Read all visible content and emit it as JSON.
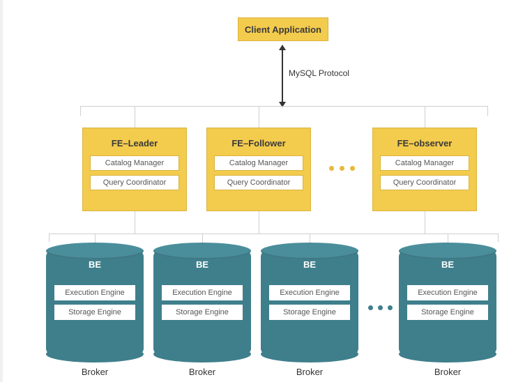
{
  "colors": {
    "yellow": "#f3cb4d",
    "yellow_border": "#d9b33e",
    "teal": "#3f7f8c",
    "teal_top": "#4a8e9b"
  },
  "client": {
    "label": "Client Application"
  },
  "protocol_label": "MySQL Protocol",
  "fe_row": {
    "ellipsis": "•••",
    "nodes": [
      {
        "title": "FE–Leader",
        "sub1": "Catalog Manager",
        "sub2": "Query Coordinator"
      },
      {
        "title": "FE–Follower",
        "sub1": "Catalog Manager",
        "sub2": "Query Coordinator"
      },
      {
        "title": "FE–observer",
        "sub1": "Catalog Manager",
        "sub2": "Query Coordinator"
      }
    ]
  },
  "be_row": {
    "ellipsis": "•••",
    "nodes": [
      {
        "title": "BE",
        "sub1": "Execution Engine",
        "sub2": "Storage Engine",
        "broker": "Broker"
      },
      {
        "title": "BE",
        "sub1": "Execution Engine",
        "sub2": "Storage Engine",
        "broker": "Broker"
      },
      {
        "title": "BE",
        "sub1": "Execution Engine",
        "sub2": "Storage Engine",
        "broker": "Broker"
      },
      {
        "title": "BE",
        "sub1": "Execution Engine",
        "sub2": "Storage Engine",
        "broker": "Broker"
      }
    ]
  }
}
